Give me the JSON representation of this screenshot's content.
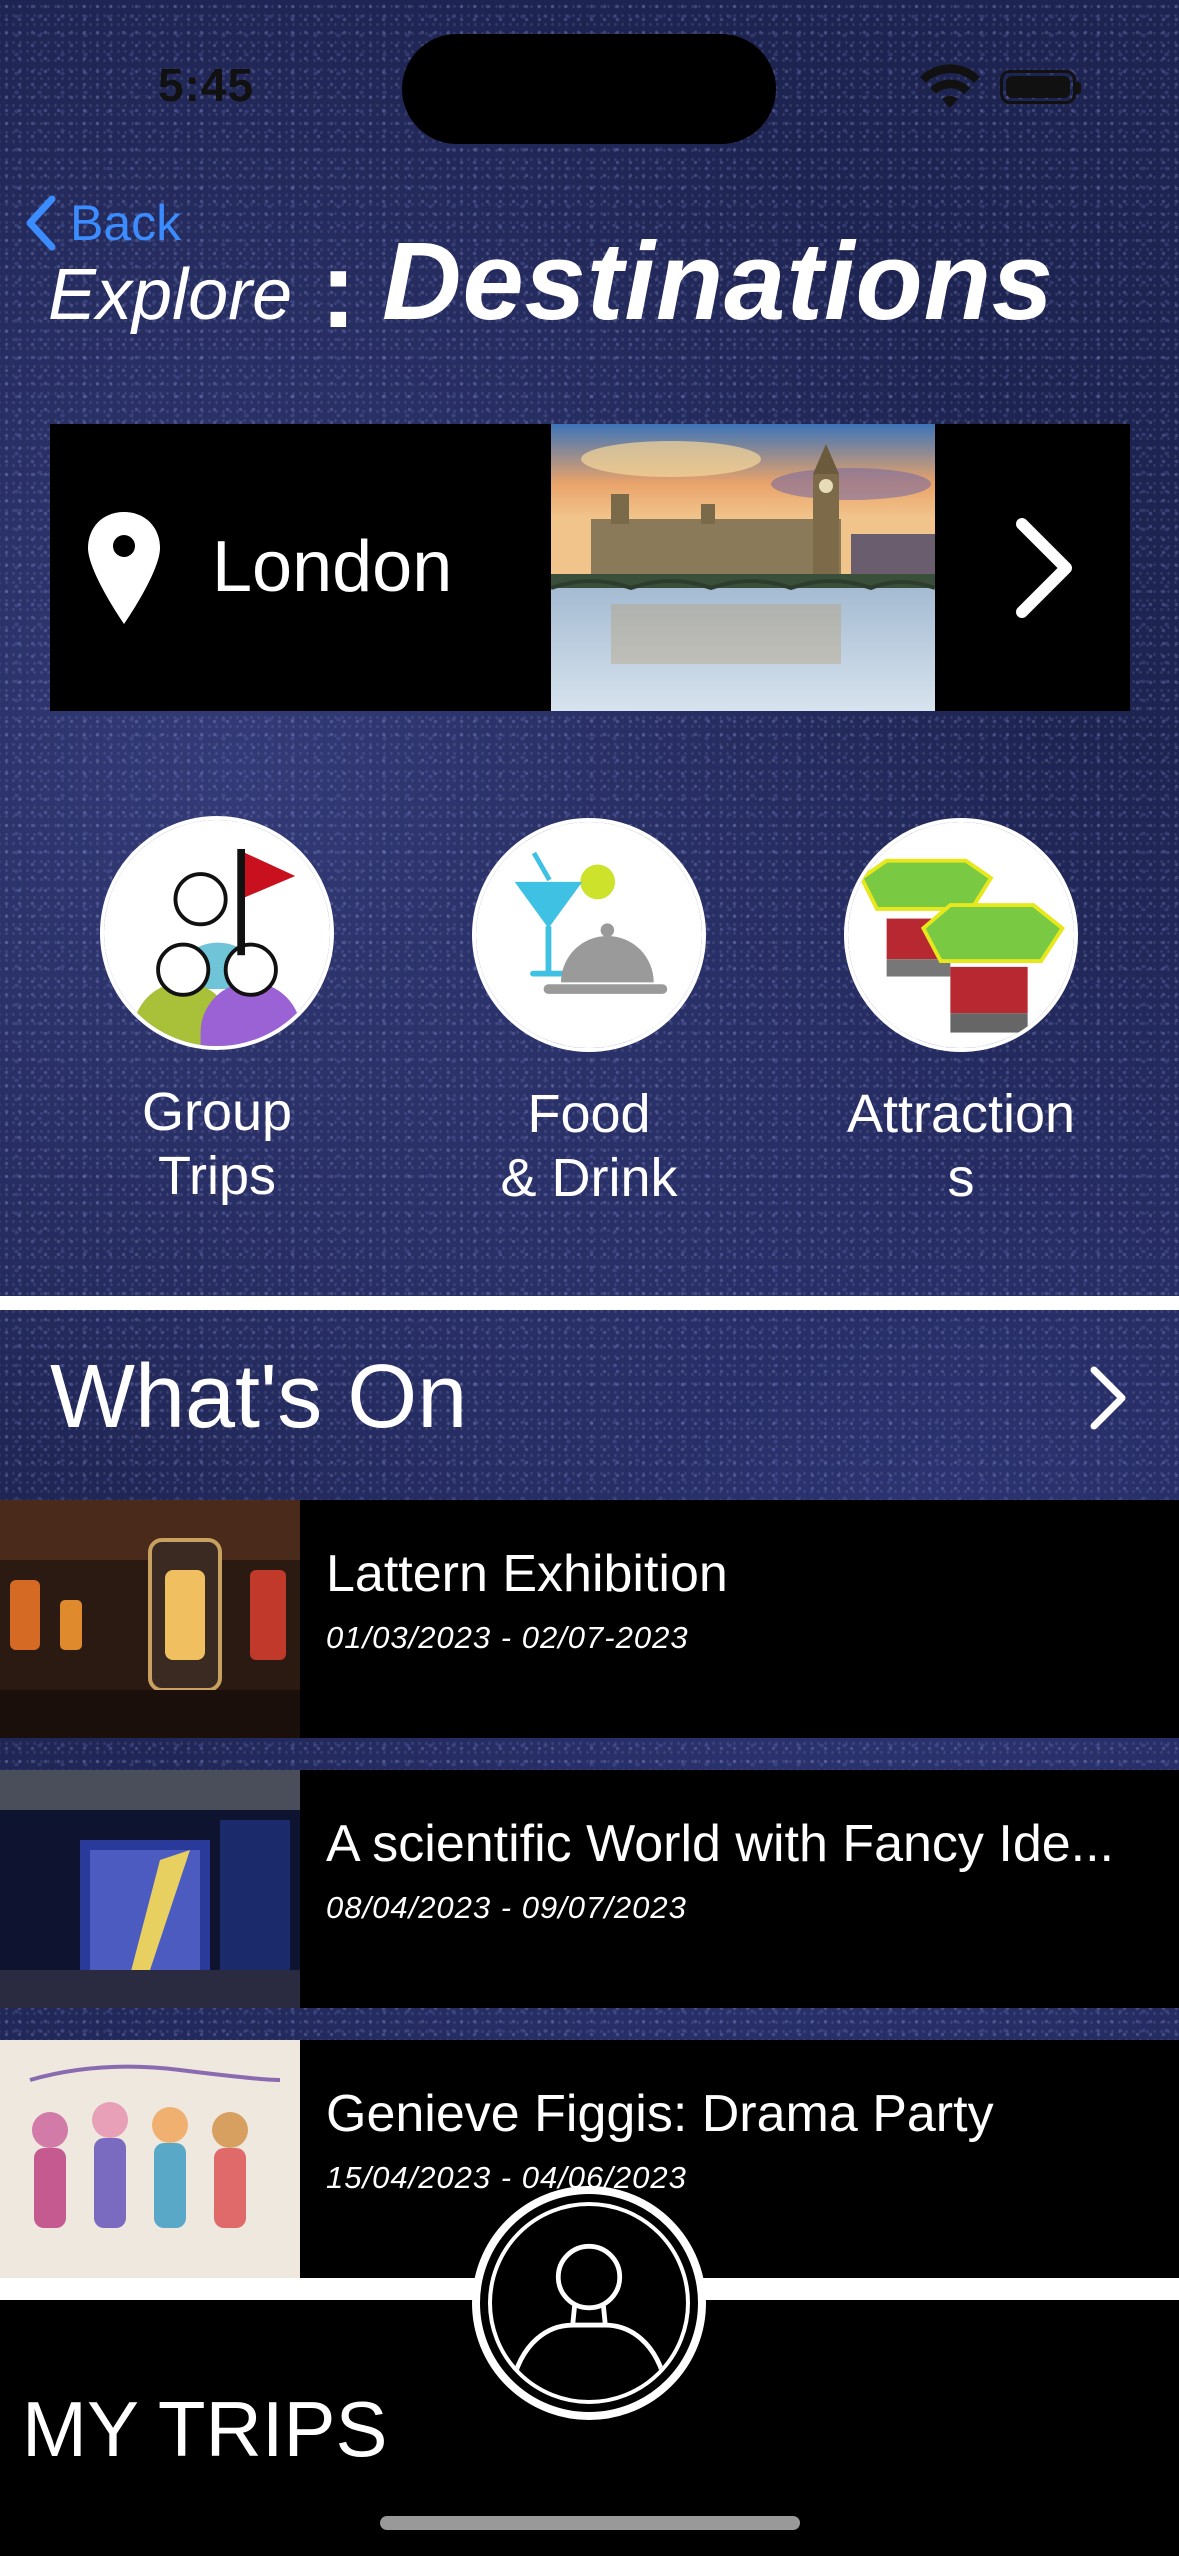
{
  "status_bar": {
    "time": "5:45",
    "icons": [
      "wifi-icon",
      "battery-icon"
    ]
  },
  "nav": {
    "back_label": "Back"
  },
  "header": {
    "explore": "Explore",
    "colon": ":",
    "title": "Destinations"
  },
  "location": {
    "name": "London",
    "icon": "location-pin-icon",
    "action_icon": "chevron-right-icon"
  },
  "categories": [
    {
      "label_line1": "Group",
      "label_line2": "Trips",
      "icon": "group-trips-icon"
    },
    {
      "label_line1": "Food",
      "label_line2": "& Drink",
      "icon": "food-drink-icon"
    },
    {
      "label_line1": "Attraction",
      "label_line2": "s",
      "icon": "attractions-icon"
    }
  ],
  "whats_on": {
    "title": "What's On",
    "events": [
      {
        "title": "Lattern Exhibition",
        "dates": "01/03/2023 - 02/07-2023"
      },
      {
        "title": "A scientific World with Fancy Ide...",
        "dates": "08/04/2023 - 09/07/2023"
      },
      {
        "title": "Genieve Figgis: Drama Party",
        "dates": "15/04/2023 - 04/06/2023"
      }
    ]
  },
  "bottom_nav": {
    "my_trips": "MY TRIPS",
    "profile_icon": "profile-icon"
  },
  "colors": {
    "background": "#1e2452",
    "accent_link": "#3b8cff",
    "card": "#000000",
    "text": "#ffffff"
  }
}
